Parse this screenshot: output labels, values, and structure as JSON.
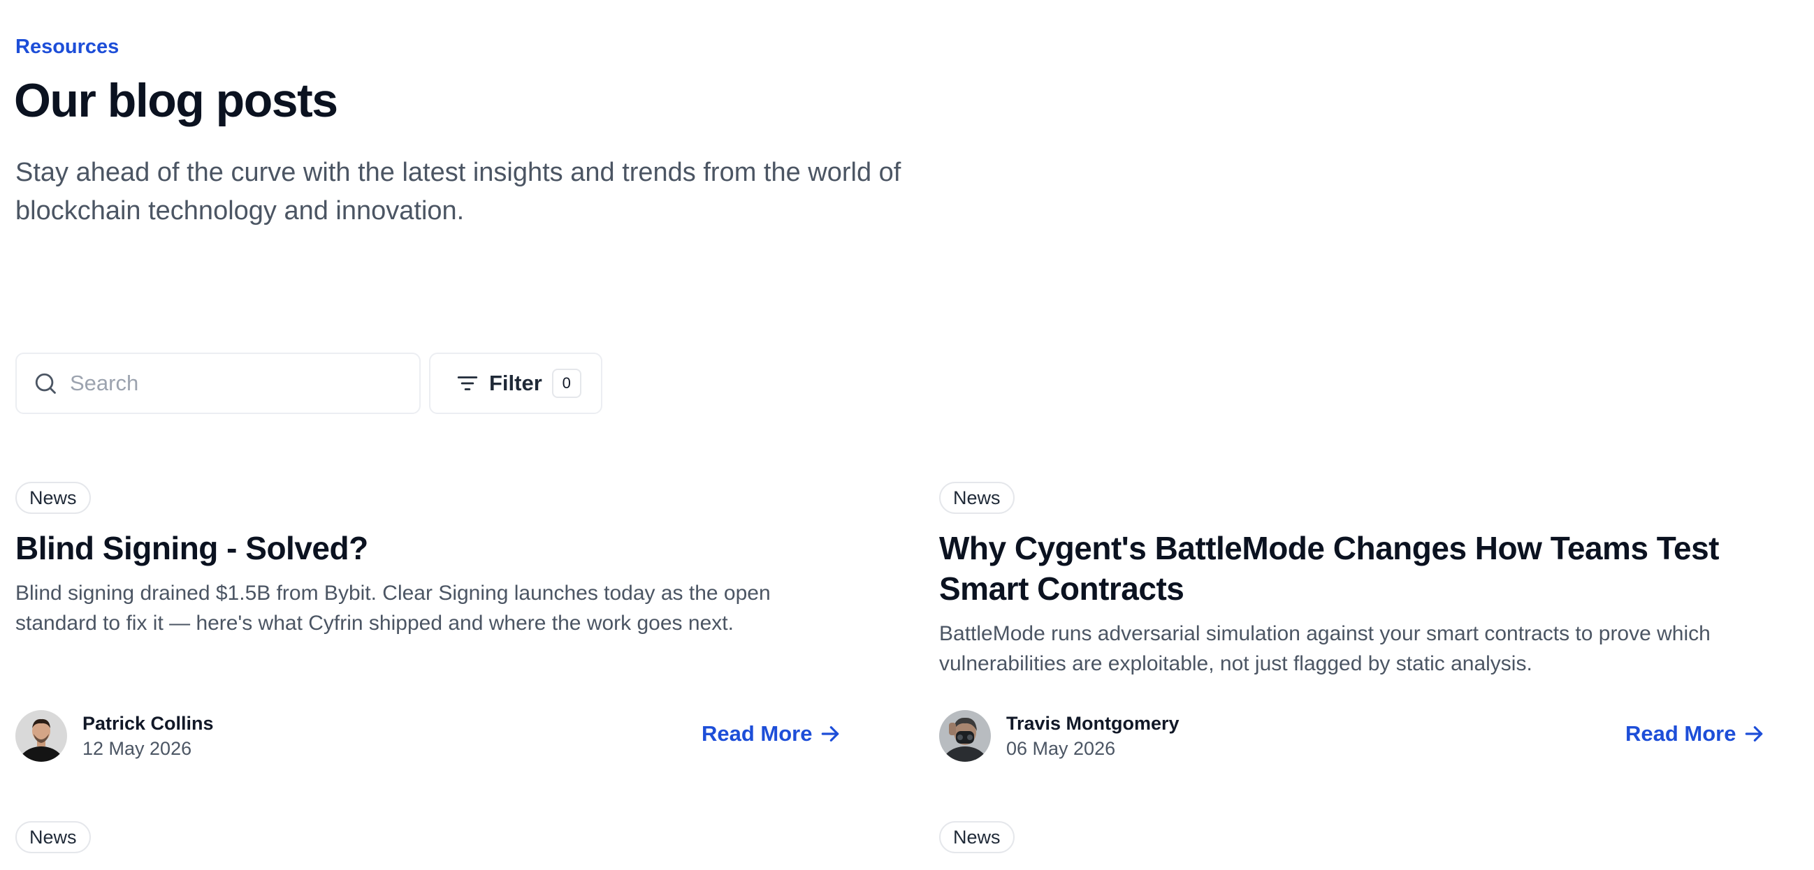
{
  "header": {
    "eyebrow": "Resources",
    "title": "Our blog posts",
    "subtitle": "Stay ahead of the curve with the latest insights and trends from the world of blockchain technology and innovation."
  },
  "search": {
    "placeholder": "Search",
    "value": ""
  },
  "filter": {
    "label": "Filter",
    "count": "0"
  },
  "posts": [
    {
      "tag": "News",
      "title": "Blind Signing - Solved?",
      "excerpt": "Blind signing drained $1.5B from Bybit. Clear Signing launches today as the open standard to fix it — here's what Cyfrin shipped and where the work goes next.",
      "author": "Patrick Collins",
      "date": "12 May 2026",
      "cta": "Read More"
    },
    {
      "tag": "News",
      "title": "Why Cygent's BattleMode Changes How Teams Test Smart Contracts",
      "excerpt": "BattleMode runs adversarial simulation against your smart contracts to prove which vulnerabilities are exploitable, not just flagged by static analysis.",
      "author": "Travis Montgomery",
      "date": "06 May 2026",
      "cta": "Read More"
    },
    {
      "tag": "News"
    },
    {
      "tag": "News"
    }
  ],
  "colors": {
    "accent": "#1d4ed8",
    "heading": "#0b1220",
    "body": "#4b5563",
    "border": "#e5e7eb"
  },
  "icons": {
    "search": "search-icon",
    "filter": "filter-lines-icon",
    "read_more": "arrow-right-icon"
  }
}
